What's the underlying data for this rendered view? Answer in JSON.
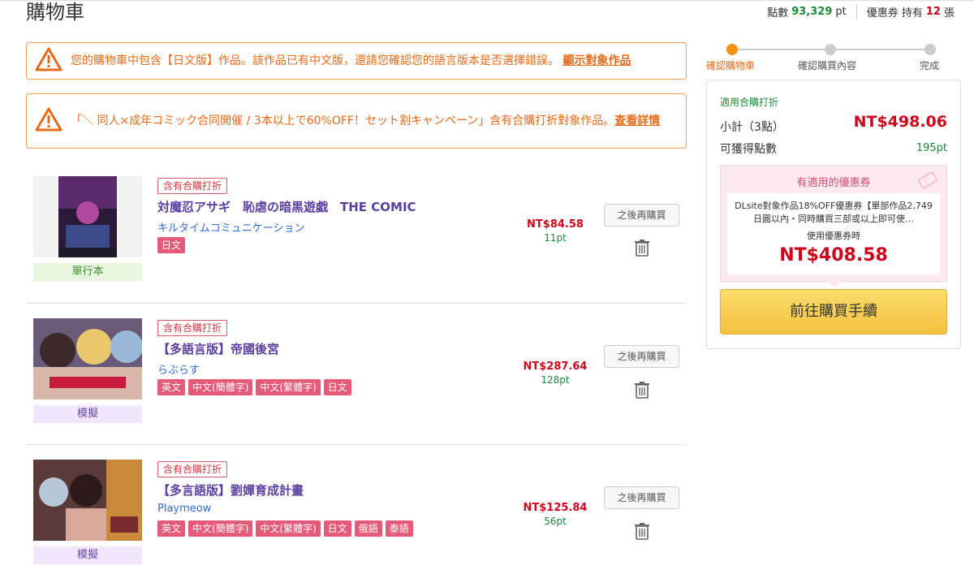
{
  "header": {
    "title": "購物車",
    "points_label": "點數",
    "points_value": "93,329",
    "points_unit": "pt",
    "coupon_label": "優惠券 持有",
    "coupon_count": "12",
    "coupon_unit": "張"
  },
  "alerts": [
    {
      "text": "您的購物車中包含【日文版】作品。該作品已有中文版，還請您確認您的語言版本是否選擇錯誤。",
      "link": "顯示對象作品"
    },
    {
      "text": "「＼ 同人×成年コミック合同開催 / 3本以上で60%OFF！セット割キャンペーン」含有合購打折對象作品。",
      "link": "查看詳情"
    }
  ],
  "items": [
    {
      "badge": "含有合購打折",
      "title": "対魔忍アサギ　恥虐の暗黒遊戯　THE COMIC",
      "maker": "キルタイムコミュニケーション",
      "langs": [
        "日文"
      ],
      "type_label": "單行本",
      "price": "NT$84.58",
      "points": "11pt",
      "later_label": "之後再購買"
    },
    {
      "badge": "含有合購打折",
      "title": "【多語言版】帝國後宮",
      "maker": "らぶらす",
      "langs": [
        "英文",
        "中文(簡體字)",
        "中文(繁體字)",
        "日文"
      ],
      "type_label": "模擬",
      "price": "NT$287.64",
      "points": "128pt",
      "later_label": "之後再購買"
    },
    {
      "badge": "含有合購打折",
      "title": "【多言語版】劉嬋育成計畫",
      "maker": "Playmeow",
      "langs": [
        "英文",
        "中文(簡體字)",
        "中文(繁體字)",
        "日文",
        "俄語",
        "泰語"
      ],
      "type_label": "模擬",
      "price": "NT$125.84",
      "points": "56pt",
      "later_label": "之後再購買"
    }
  ],
  "steps": [
    "確認購物車",
    "確認購買內容",
    "完成"
  ],
  "summary": {
    "applied_label": "適用合購打折",
    "subtotal_label": "小計（3點）",
    "subtotal_value": "NT$498.06",
    "earn_label": "可獲得點數",
    "earn_value": "195pt",
    "coupon_title": "有適用的優惠券",
    "coupon_desc": "DLsite對象作品18%OFF優惠券【單部作品2,749日圓以內・同時購買三部或以上即可使…",
    "coupon_use_label": "使用優惠券時",
    "coupon_price": "NT$408.58",
    "buy_label": "前往購買手續"
  },
  "colors": {
    "accent_orange": "#e66a18",
    "price_red": "#d0021b",
    "points_green": "#1a8a3a",
    "title_purple": "#5b3fa0",
    "lang_pink": "#e55a78"
  }
}
